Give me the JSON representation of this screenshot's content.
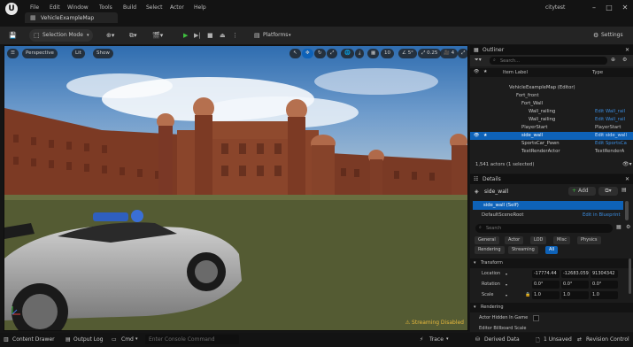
{
  "menu": {
    "items": [
      "File",
      "Edit",
      "Window",
      "Tools",
      "Build",
      "Select",
      "Actor",
      "Help"
    ],
    "project": "citytest"
  },
  "tab": {
    "title": "VehicleExampleMap"
  },
  "toolbar": {
    "selection_mode": "Selection Mode",
    "platforms": "Platforms",
    "settings": "Settings"
  },
  "viewport": {
    "perspective": "Perspective",
    "lit": "Lit",
    "show": "Show",
    "angle": "5°",
    "scale": "0.25",
    "camera_speed": "4",
    "streaming": "Streaming Disabled"
  },
  "outliner": {
    "title": "Outliner",
    "search_placeholder": "Search...",
    "col_label": "Item Label",
    "col_type": "Type",
    "rows": [
      {
        "label": "VehicleExampleMap (Editor)",
        "type": ""
      },
      {
        "label": "Fort_front",
        "type": ""
      },
      {
        "label": "Fort_Wall",
        "type": ""
      },
      {
        "label": "Wall_railing",
        "type": "Edit Wall_rail"
      },
      {
        "label": "Wall_railing",
        "type": "Edit Wall_rail"
      },
      {
        "label": "PlayerStart",
        "type": "PlayerStart"
      },
      {
        "label": "side_wall",
        "type": "Edit side_wall"
      },
      {
        "label": "SportsCar_Pawn",
        "type": "Edit SportsCa"
      },
      {
        "label": "TextRenderActor",
        "type": "TextRenderA"
      }
    ],
    "count": "1,541 actors (1 selected)"
  },
  "details": {
    "title": "Details",
    "actor_name": "side_wall",
    "add_label": "Add",
    "self_label": "side_wall (Self)",
    "root_label": "DefaultSceneRoot",
    "root_link": "Edit in Blueprint",
    "search_placeholder": "Search",
    "filters": [
      "General",
      "Actor",
      "LOD",
      "Misc",
      "Physics",
      "Rendering",
      "Streaming",
      "All"
    ],
    "transform_header": "Transform",
    "location_label": "Location",
    "location_values": [
      "-17774.44",
      "-12683.059",
      "91304342"
    ],
    "rotation_label": "Rotation",
    "rotation_values": [
      "0.0°",
      "0.0°",
      "0.0°"
    ],
    "scale_label": "Scale",
    "scale_values": [
      "1.0",
      "1.0",
      "1.0"
    ],
    "rendering_header": "Rendering",
    "hidden_label": "Actor Hidden In Game",
    "editor_billboard_label": "Editor Billboard Scale"
  },
  "status": {
    "content_drawer": "Content Drawer",
    "output_log": "Output Log",
    "cmd": "Cmd",
    "console_placeholder": "Enter Console Command",
    "trace": "Trace",
    "derived_data": "Derived Data",
    "unsaved": "1 Unsaved",
    "revision_control": "Revision Control"
  },
  "colors": {
    "accent_blue": "#0e62b8",
    "play_green": "#3fbf3f",
    "warning": "#e8b93c",
    "link_blue": "#3b8de0"
  }
}
